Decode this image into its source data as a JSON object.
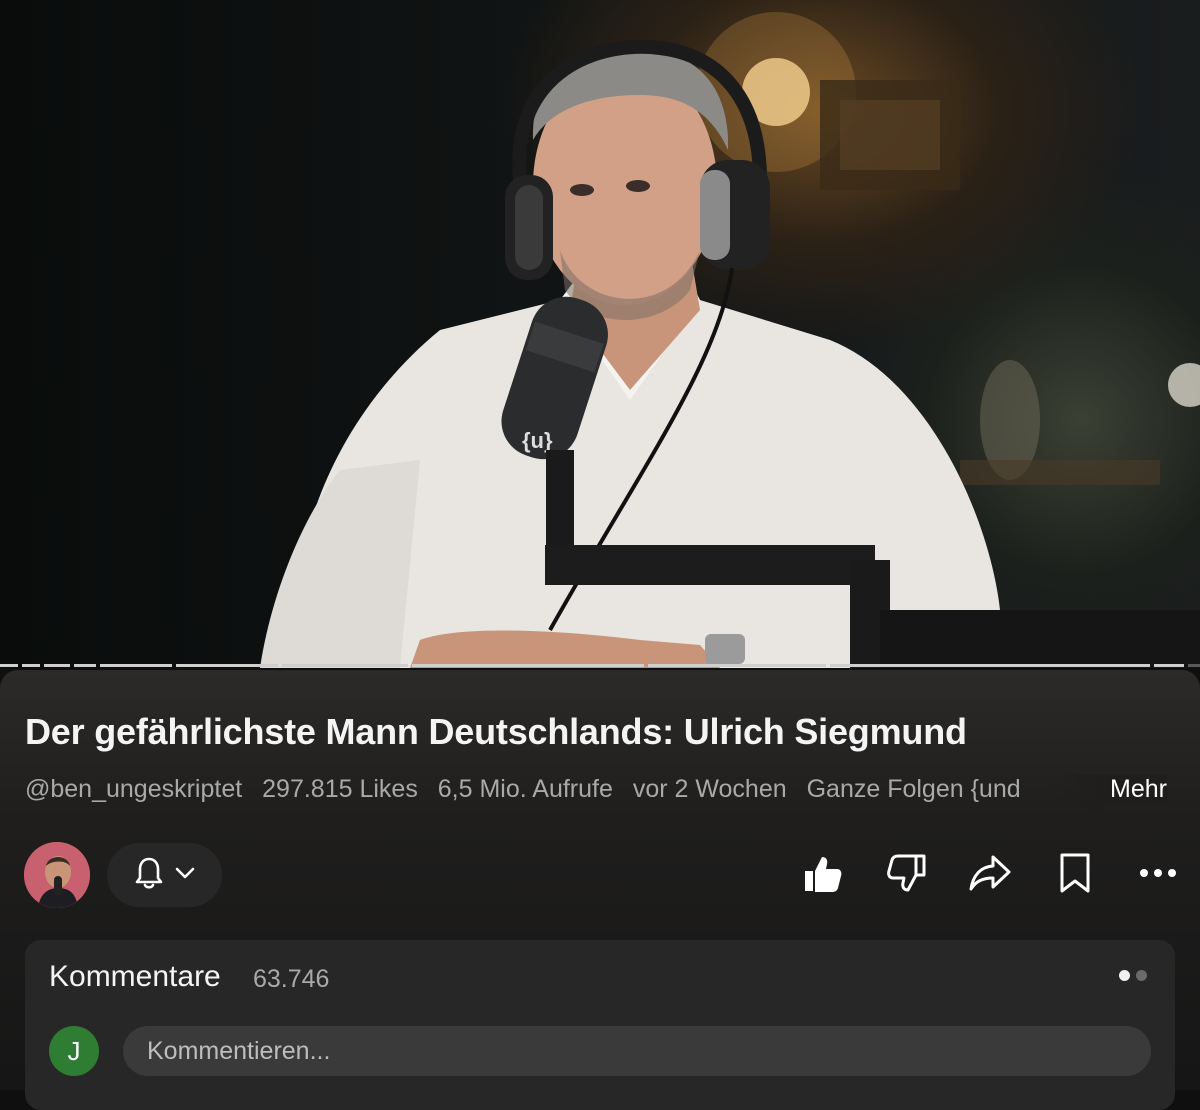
{
  "video": {
    "mic_brand": "{u}",
    "progress_fraction": 0.96
  },
  "title": "Der gefährlichste Mann Deutschlands: Ulrich Siegmund",
  "meta": {
    "channel": "@ben_ungeskriptet",
    "likes": "297.815 Likes",
    "views": "6,5 Mio. Aufrufe",
    "age": "vor 2 Wochen",
    "description_snippet": "Ganze Folgen {und",
    "more_label": "Mehr"
  },
  "actions": {
    "bell_icon": "bell-icon",
    "like_icon": "thumbs-up-icon",
    "dislike_icon": "thumbs-down-icon",
    "share_icon": "share-icon",
    "save_icon": "bookmark-icon",
    "more_icon": "more-horizontal-icon"
  },
  "comments": {
    "title": "Kommentare",
    "count": "63.746",
    "user_initial": "J",
    "placeholder": "Kommentieren..."
  },
  "colors": {
    "background": "#0f0f0f",
    "card": "#272727",
    "user_avatar": "#2f7d32",
    "meta_text": "#a9a9a9"
  }
}
